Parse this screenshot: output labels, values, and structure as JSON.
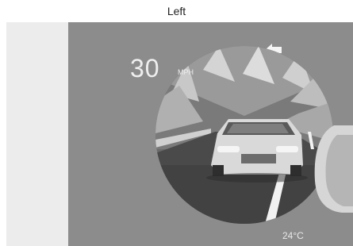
{
  "caption": "Left",
  "display": {
    "speed_value": "30",
    "speed_unit": "MPH",
    "temperature": "24°C",
    "direction_icon": "arrow-left-icon",
    "colors": {
      "background": "#8c8c8c",
      "side_panel": "#ececec",
      "text": "#efefef"
    }
  }
}
